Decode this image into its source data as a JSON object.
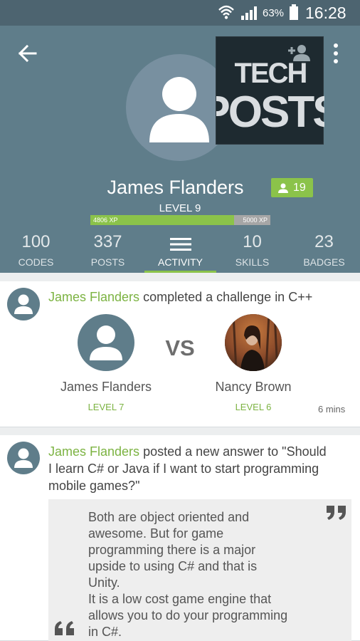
{
  "status_bar": {
    "battery_percent": "63%",
    "time": "16:28"
  },
  "profile": {
    "name": "James Flanders",
    "followers": "19",
    "level": "LEVEL 9",
    "xp_current": "4806 XP",
    "xp_max": "5000 XP",
    "xp_progress": 0.8,
    "logo_text": [
      "TECH",
      "POSTS"
    ]
  },
  "stats": [
    {
      "number": "100",
      "label": "CODES"
    },
    {
      "number": "337",
      "label": "POSTS"
    },
    {
      "number": "",
      "label": "ACTIVITY"
    },
    {
      "number": "10",
      "label": "SKILLS"
    },
    {
      "number": "23",
      "label": "BADGES"
    }
  ],
  "feed": [
    {
      "user": "James Flanders",
      "action": " completed a challenge in C++",
      "vs": "VS",
      "player1": {
        "name": "James Flanders",
        "level": "LEVEL 7"
      },
      "player2": {
        "name": "Nancy Brown",
        "level": "LEVEL 6"
      },
      "time": "6 mins"
    },
    {
      "user": "James Flanders",
      "action_lines": [
        " posted a new answer to \"Should",
        "I learn C# or Java if I want to start programming",
        "mobile games?\""
      ],
      "quote_lines": [
        "Both are object oriented and",
        "awesome. But for game",
        "programming there is a major",
        "upside to using C# and that is",
        "Unity.",
        "It is a low cost game engine that",
        "allows you to do your programming",
        "in C#."
      ]
    }
  ],
  "colors": {
    "header": "#5f7d8a",
    "status_bar": "#4d6470",
    "accent": "#8bc34a"
  }
}
